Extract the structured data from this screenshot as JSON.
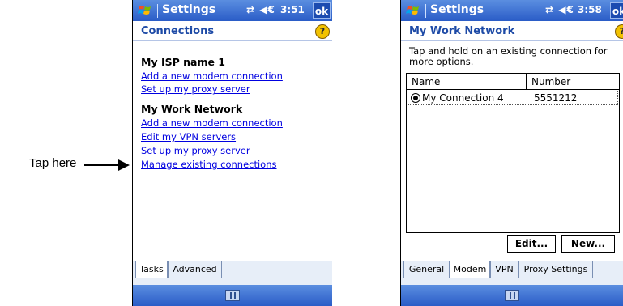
{
  "callout": {
    "text": "Tap here"
  },
  "left_screen": {
    "title": "Settings",
    "status_icons": "⇄ ◀€",
    "time": "3:51",
    "ok_label": "ok",
    "header_title": "Connections",
    "help_glyph": "?",
    "groups": [
      {
        "title": "My ISP name 1",
        "links": [
          "Add a new modem connection",
          "Set up my proxy server"
        ]
      },
      {
        "title": "My Work Network",
        "links": [
          "Add a new modem connection",
          "Edit my VPN servers",
          "Set up my proxy server",
          "Manage existing connections"
        ]
      }
    ],
    "tabs": [
      {
        "label": "Tasks",
        "active": true
      },
      {
        "label": "Advanced",
        "active": false
      }
    ]
  },
  "right_screen": {
    "title": "Settings",
    "status_icons": "⇄ ◀€",
    "time": "3:58",
    "ok_label": "ok",
    "header_title": "My Work Network",
    "help_glyph": "?",
    "description": "Tap and hold on an existing connection for more options.",
    "columns": [
      "Name",
      "Number"
    ],
    "rows": [
      {
        "name": "My Connection 4",
        "number": "5551212",
        "selected": true
      }
    ],
    "buttons": {
      "edit": "Edit...",
      "new": "New..."
    },
    "tabs": [
      {
        "label": "General",
        "active": false
      },
      {
        "label": "Modem",
        "active": true
      },
      {
        "label": "VPN",
        "active": false
      },
      {
        "label": "Proxy Settings",
        "active": false
      }
    ]
  }
}
